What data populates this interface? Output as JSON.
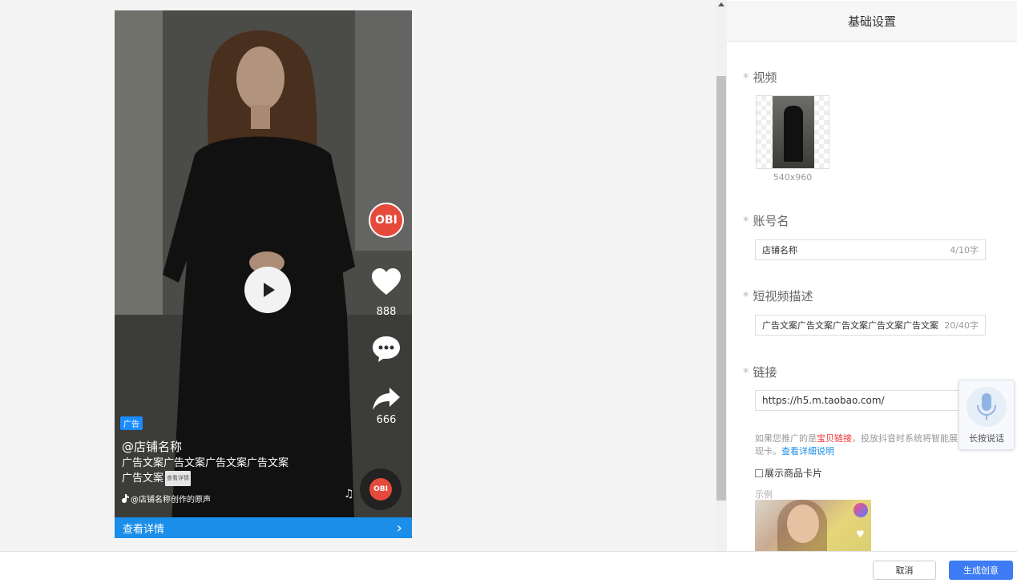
{
  "preview": {
    "ad_badge": "广告",
    "shop_name": "@店铺名称",
    "ad_copy": "广告文案广告文案广告文案广告文案广告文案",
    "detail_tag": "查看详情",
    "music_credit": "@店铺名称创作的原声",
    "like_count": "888",
    "share_count": "666",
    "avatar_text": "OBI",
    "detail_bar_label": "查看详情",
    "detail_bar_arrow": "›"
  },
  "settings": {
    "title": "基础设置",
    "video": {
      "label": "视频",
      "size": "540x960"
    },
    "account": {
      "label": "账号名",
      "value": "店铺名称",
      "count": "4/10字"
    },
    "description": {
      "label": "短视频描述",
      "value": "广告文案广告文案广告文案广告文案广告文案",
      "count": "20/40字"
    },
    "link": {
      "label": "链接",
      "value": "https://h5.m.taobao.com/",
      "hint_prefix": "如果您推广的是",
      "hint_red": "宝贝链接",
      "hint_middle": "，投放抖音时系统将智能展现",
      "hint_end": "卡。",
      "hint_link": "查看详细说明"
    },
    "show_product_card": {
      "label": "展示商品卡片",
      "checked": false
    },
    "example_label": "示例"
  },
  "voice_widget": {
    "label": "长按说话"
  },
  "footer": {
    "cancel_label": "取消",
    "generate_label": "生成创意"
  },
  "colors": {
    "primary": "#3d7cf4",
    "detail_bar": "#1b8ee9",
    "hint_red": "#e33333",
    "avatar_red": "#e64a3b"
  },
  "icons": [
    "play-icon",
    "heart-icon",
    "comment-icon",
    "share-icon",
    "music-icon",
    "microphone-icon",
    "chevron-right-icon",
    "scroll-up-icon"
  ]
}
